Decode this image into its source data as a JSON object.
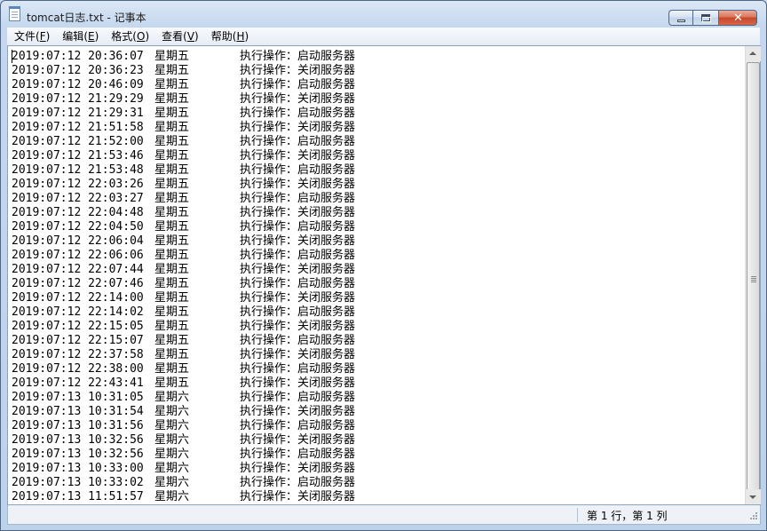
{
  "window": {
    "title": "tomcat日志.txt - 记事本"
  },
  "menu": [
    {
      "label": "文件",
      "key": "F"
    },
    {
      "label": "编辑",
      "key": "E"
    },
    {
      "label": "格式",
      "key": "O"
    },
    {
      "label": "查看",
      "key": "V"
    },
    {
      "label": "帮助",
      "key": "H"
    }
  ],
  "lines": [
    {
      "date": "2019:07:12",
      "time": "20:36:07",
      "weekday": "星期五",
      "action": "执行操作：启动服务器"
    },
    {
      "date": "2019:07:12",
      "time": "20:36:23",
      "weekday": "星期五",
      "action": "执行操作：关闭服务器"
    },
    {
      "date": "2019:07:12",
      "time": "20:46:09",
      "weekday": "星期五",
      "action": "执行操作：启动服务器"
    },
    {
      "date": "2019:07:12",
      "time": "21:29:29",
      "weekday": "星期五",
      "action": "执行操作：关闭服务器"
    },
    {
      "date": "2019:07:12",
      "time": "21:29:31",
      "weekday": "星期五",
      "action": "执行操作：启动服务器"
    },
    {
      "date": "2019:07:12",
      "time": "21:51:58",
      "weekday": "星期五",
      "action": "执行操作：关闭服务器"
    },
    {
      "date": "2019:07:12",
      "time": "21:52:00",
      "weekday": "星期五",
      "action": "执行操作：启动服务器"
    },
    {
      "date": "2019:07:12",
      "time": "21:53:46",
      "weekday": "星期五",
      "action": "执行操作：关闭服务器"
    },
    {
      "date": "2019:07:12",
      "time": "21:53:48",
      "weekday": "星期五",
      "action": "执行操作：启动服务器"
    },
    {
      "date": "2019:07:12",
      "time": "22:03:26",
      "weekday": "星期五",
      "action": "执行操作：关闭服务器"
    },
    {
      "date": "2019:07:12",
      "time": "22:03:27",
      "weekday": "星期五",
      "action": "执行操作：启动服务器"
    },
    {
      "date": "2019:07:12",
      "time": "22:04:48",
      "weekday": "星期五",
      "action": "执行操作：关闭服务器"
    },
    {
      "date": "2019:07:12",
      "time": "22:04:50",
      "weekday": "星期五",
      "action": "执行操作：启动服务器"
    },
    {
      "date": "2019:07:12",
      "time": "22:06:04",
      "weekday": "星期五",
      "action": "执行操作：关闭服务器"
    },
    {
      "date": "2019:07:12",
      "time": "22:06:06",
      "weekday": "星期五",
      "action": "执行操作：启动服务器"
    },
    {
      "date": "2019:07:12",
      "time": "22:07:44",
      "weekday": "星期五",
      "action": "执行操作：关闭服务器"
    },
    {
      "date": "2019:07:12",
      "time": "22:07:46",
      "weekday": "星期五",
      "action": "执行操作：启动服务器"
    },
    {
      "date": "2019:07:12",
      "time": "22:14:00",
      "weekday": "星期五",
      "action": "执行操作：关闭服务器"
    },
    {
      "date": "2019:07:12",
      "time": "22:14:02",
      "weekday": "星期五",
      "action": "执行操作：启动服务器"
    },
    {
      "date": "2019:07:12",
      "time": "22:15:05",
      "weekday": "星期五",
      "action": "执行操作：关闭服务器"
    },
    {
      "date": "2019:07:12",
      "time": "22:15:07",
      "weekday": "星期五",
      "action": "执行操作：启动服务器"
    },
    {
      "date": "2019:07:12",
      "time": "22:37:58",
      "weekday": "星期五",
      "action": "执行操作：关闭服务器"
    },
    {
      "date": "2019:07:12",
      "time": "22:38:00",
      "weekday": "星期五",
      "action": "执行操作：启动服务器"
    },
    {
      "date": "2019:07:12",
      "time": "22:43:41",
      "weekday": "星期五",
      "action": "执行操作：关闭服务器"
    },
    {
      "date": "2019:07:13",
      "time": "10:31:05",
      "weekday": "星期六",
      "action": "执行操作：启动服务器"
    },
    {
      "date": "2019:07:13",
      "time": "10:31:54",
      "weekday": "星期六",
      "action": "执行操作：关闭服务器"
    },
    {
      "date": "2019:07:13",
      "time": "10:31:56",
      "weekday": "星期六",
      "action": "执行操作：启动服务器"
    },
    {
      "date": "2019:07:13",
      "time": "10:32:56",
      "weekday": "星期六",
      "action": "执行操作：关闭服务器"
    },
    {
      "date": "2019:07:13",
      "time": "10:32:56",
      "weekday": "星期六",
      "action": "执行操作：启动服务器"
    },
    {
      "date": "2019:07:13",
      "time": "10:33:00",
      "weekday": "星期六",
      "action": "执行操作：关闭服务器"
    },
    {
      "date": "2019:07:13",
      "time": "10:33:02",
      "weekday": "星期六",
      "action": "执行操作：启动服务器"
    },
    {
      "date": "2019:07:13",
      "time": "11:51:57",
      "weekday": "星期六",
      "action": "执行操作：关闭服务器"
    }
  ],
  "status": {
    "position": "第 1 行，第 1 列"
  }
}
